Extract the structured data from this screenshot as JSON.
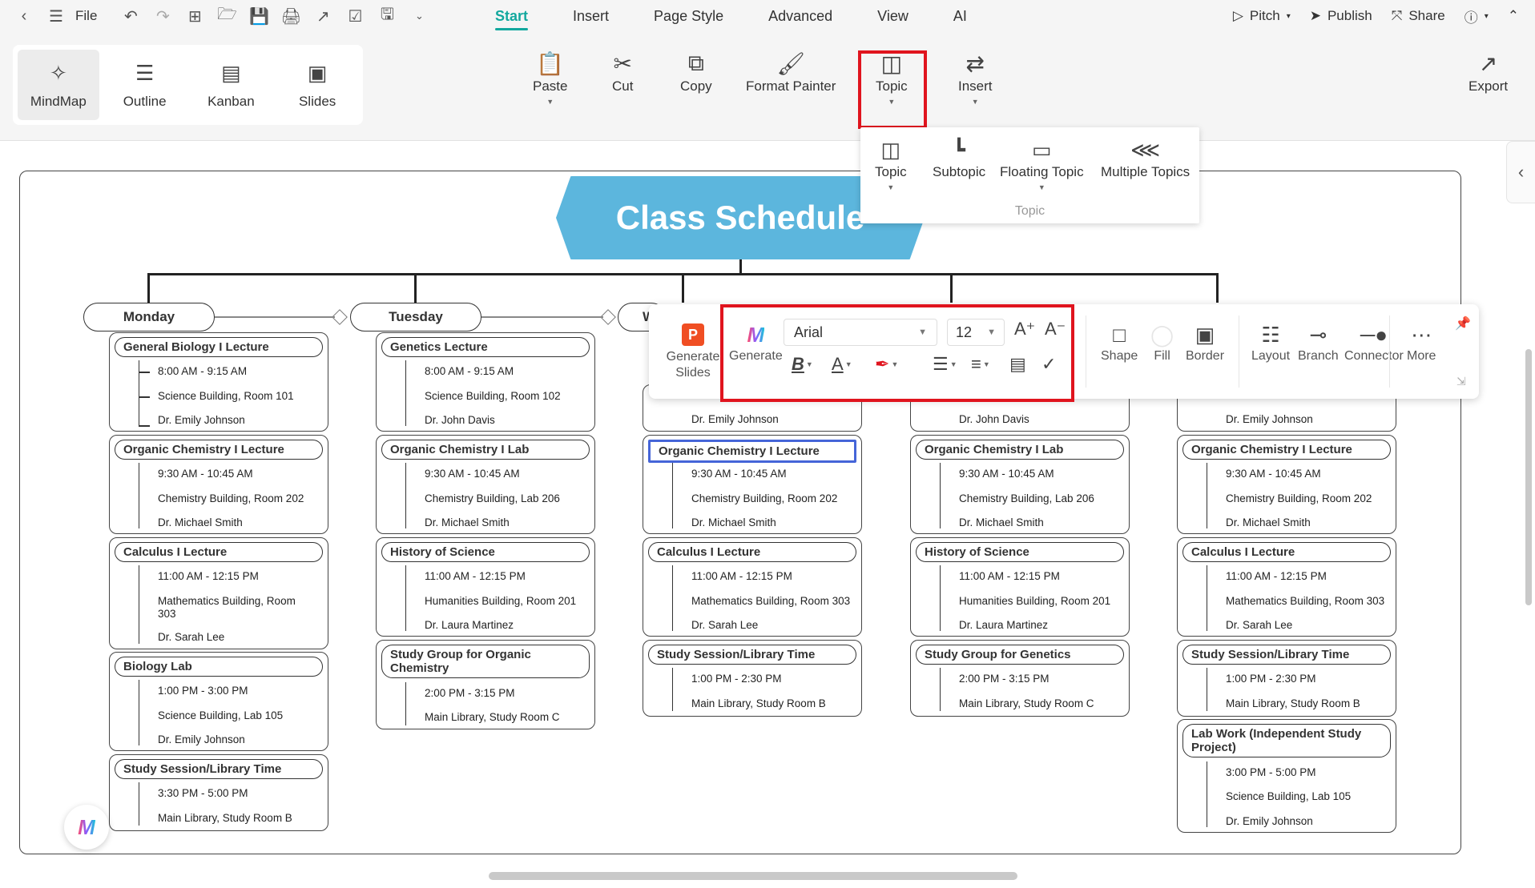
{
  "menubar": {
    "file_label": "File",
    "tabs": [
      "Start",
      "Insert",
      "Page Style",
      "Advanced",
      "View",
      "AI"
    ],
    "pitch_label": "Pitch",
    "publish_label": "Publish",
    "share_label": "Share"
  },
  "ribbon": {
    "views": [
      "MindMap",
      "Outline",
      "Kanban",
      "Slides"
    ],
    "paste_label": "Paste",
    "cut_label": "Cut",
    "copy_label": "Copy",
    "format_painter_label": "Format Painter",
    "topic_label": "Topic",
    "insert_label": "Insert",
    "export_label": "Export"
  },
  "topic_dropdown": {
    "items": [
      "Topic",
      "Subtopic",
      "Floating Topic",
      "Multiple Topics"
    ],
    "group_label": "Topic"
  },
  "root": {
    "title": "Class Schedule"
  },
  "days": [
    {
      "name": "Monday",
      "classes": [
        {
          "title": "General Biology I Lecture",
          "details": [
            "8:00 AM - 9:15 AM",
            "Science Building, Room 101",
            "Dr. Emily Johnson"
          ]
        },
        {
          "title": "Organic Chemistry I Lecture",
          "details": [
            "9:30 AM - 10:45 AM",
            "Chemistry Building, Room 202",
            "Dr. Michael Smith"
          ]
        },
        {
          "title": "Calculus I Lecture",
          "details": [
            "11:00 AM - 12:15 PM",
            "Mathematics Building, Room 303",
            "Dr. Sarah Lee"
          ]
        },
        {
          "title": "Biology Lab",
          "details": [
            "1:00 PM - 3:00 PM",
            "Science Building, Lab 105",
            "Dr. Emily Johnson"
          ]
        },
        {
          "title": "Study Session/Library Time",
          "details": [
            "3:30 PM - 5:00 PM",
            "Main Library, Study Room B"
          ]
        }
      ]
    },
    {
      "name": "Tuesday",
      "classes": [
        {
          "title": "Genetics Lecture",
          "details": [
            "8:00 AM - 9:15 AM",
            "Science Building, Room 102",
            "Dr. John Davis"
          ]
        },
        {
          "title": "Organic Chemistry I Lab",
          "details": [
            "9:30 AM - 10:45 AM",
            "Chemistry Building, Lab 206",
            "Dr. Michael Smith"
          ]
        },
        {
          "title": "History of Science",
          "details": [
            "11:00 AM - 12:15 PM",
            "Humanities Building, Room 201",
            "Dr. Laura Martinez"
          ]
        },
        {
          "title": "Study Group for Organic Chemistry",
          "details": [
            "2:00 PM - 3:15 PM",
            "Main Library, Study Room C"
          ]
        }
      ]
    },
    {
      "name": "W",
      "classes": [
        {
          "title": "",
          "details": [
            "Dr. Emily Johnson"
          ]
        },
        {
          "title": "Organic Chemistry I Lecture",
          "details": [
            "9:30 AM - 10:45 AM",
            "Chemistry Building, Room 202",
            "Dr. Michael Smith"
          ]
        },
        {
          "title": "Calculus I Lecture",
          "details": [
            "11:00 AM - 12:15 PM",
            "Mathematics Building, Room 303",
            "Dr. Sarah Lee"
          ]
        },
        {
          "title": "Study Session/Library Time",
          "details": [
            "1:00 PM - 2:30 PM",
            "Main Library, Study Room B"
          ]
        }
      ]
    },
    {
      "name": "",
      "classes": [
        {
          "title": "",
          "details": [
            "Dr. John Davis"
          ]
        },
        {
          "title": "Organic Chemistry I Lab",
          "details": [
            "9:30 AM - 10:45 AM",
            "Chemistry Building, Lab 206",
            "Dr. Michael Smith"
          ]
        },
        {
          "title": "History of Science",
          "details": [
            "11:00 AM - 12:15 PM",
            "Humanities Building, Room 201",
            "Dr. Laura Martinez"
          ]
        },
        {
          "title": "Study Group for Genetics",
          "details": [
            "2:00 PM - 3:15 PM",
            "Main Library, Study Room C"
          ]
        }
      ]
    },
    {
      "name": "",
      "classes": [
        {
          "title": "",
          "details": [
            "Dr. Emily Johnson"
          ]
        },
        {
          "title": "Organic Chemistry I Lecture",
          "details": [
            "9:30 AM - 10:45 AM",
            "Chemistry Building, Room 202",
            "Dr. Michael Smith"
          ]
        },
        {
          "title": "Calculus I Lecture",
          "details": [
            "11:00 AM - 12:15 PM",
            "Mathematics Building, Room 303",
            "Dr. Sarah Lee"
          ]
        },
        {
          "title": "Study Session/Library Time",
          "details": [
            "1:00 PM - 2:30 PM",
            "Main Library, Study Room B"
          ]
        },
        {
          "title": "Lab Work (Independent Study Project)",
          "details": [
            "3:00 PM - 5:00 PM",
            "Science Building, Lab 105",
            "Dr. Emily Johnson"
          ]
        }
      ]
    }
  ],
  "float_toolbar": {
    "generate_slides_label": "Generate Slides",
    "generate_label": "Generate",
    "font_family": "Arial",
    "font_size": "12",
    "shape_label": "Shape",
    "fill_label": "Fill",
    "border_label": "Border",
    "layout_label": "Layout",
    "branch_label": "Branch",
    "connector_label": "Connector",
    "more_label": "More"
  },
  "colors": {
    "accent": "#13a89e",
    "root_fill": "#5cb6dd",
    "highlight": "#e0141e",
    "selection": "#4565d8"
  }
}
